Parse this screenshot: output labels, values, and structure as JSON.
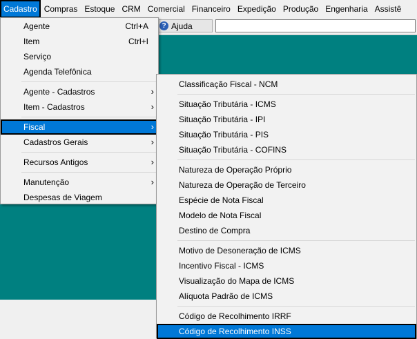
{
  "menubar": {
    "items": [
      "Cadastro",
      "Compras",
      "Estoque",
      "CRM",
      "Comercial",
      "Financeiro",
      "Expedição",
      "Produção",
      "Engenharia",
      "Assistê"
    ]
  },
  "toolbar": {
    "help_label": "Ajuda",
    "help_icon": "help-icon",
    "input_value": ""
  },
  "cadastro_menu": {
    "groups": [
      [
        {
          "label": "Agente",
          "shortcut": "Ctrl+A"
        },
        {
          "label": "Item",
          "shortcut": "Ctrl+I"
        },
        {
          "label": "Serviço",
          "shortcut": ""
        },
        {
          "label": "Agenda Telefônica",
          "shortcut": ""
        }
      ],
      [
        {
          "label": "Agente - Cadastros",
          "submenu": true
        },
        {
          "label": "Item - Cadastros",
          "submenu": true
        }
      ],
      [
        {
          "label": "Fiscal",
          "submenu": true,
          "selected": true
        },
        {
          "label": "Cadastros Gerais",
          "submenu": true
        }
      ],
      [
        {
          "label": "Recursos Antigos",
          "submenu": true
        }
      ],
      [
        {
          "label": "Manutenção",
          "submenu": true
        },
        {
          "label": "Despesas de Viagem"
        }
      ]
    ]
  },
  "fiscal_submenu": {
    "groups": [
      [
        "Classificação Fiscal - NCM"
      ],
      [
        "Situação Tributária  - ICMS",
        "Situação Tributária - IPI",
        "Situação Tributária - PIS",
        "Situação Tributária - COFINS"
      ],
      [
        "Natureza de Operação Próprio",
        "Natureza de Operação de Terceiro",
        "Espécie de Nota Fiscal",
        "Modelo de Nota Fiscal",
        "Destino de Compra"
      ],
      [
        "Motivo de Desoneração de ICMS",
        "Incentivo Fiscal - ICMS",
        "Visualização do Mapa de ICMS",
        "Alíquota Padrão de ICMS"
      ],
      [
        "Código de Recolhimento IRRF",
        "Código de Recolhimento INSS"
      ]
    ],
    "selected": "Código de Recolhimento INSS"
  },
  "colors": {
    "workspace": "#008080",
    "highlight": "#0078d7",
    "menu_bg": "#f2f2f2"
  }
}
